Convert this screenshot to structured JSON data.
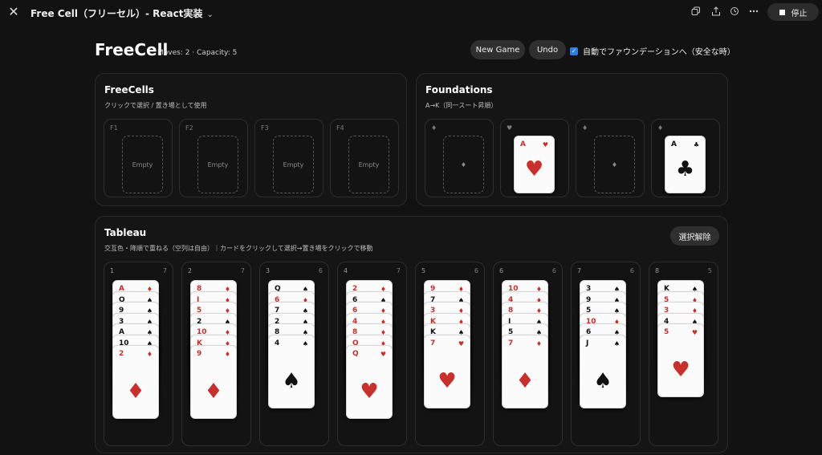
{
  "topbar": {
    "title": "Free Cell（フリーセル）- React実装",
    "chevron": "⌄",
    "close": "✕",
    "icons": [
      "copy-icon",
      "share-icon",
      "history-icon",
      "more-icon"
    ],
    "stop_label": "停止"
  },
  "header": {
    "title": "FreeCell",
    "subtitle": "Moves: 2 · Capacity: 5",
    "new_game": "New Game",
    "undo": "Undo",
    "auto_label": "自動でファウンデーションへ（安全な時）",
    "auto_checked": true
  },
  "freecells": {
    "title": "FreeCells",
    "subtitle": "クリックで選択 / 置き場として使用",
    "slots": [
      {
        "label": "F1",
        "text": "Empty"
      },
      {
        "label": "F2",
        "text": "Empty"
      },
      {
        "label": "F3",
        "text": "Empty"
      },
      {
        "label": "F4",
        "text": "Empty"
      }
    ]
  },
  "foundations": {
    "title": "Foundations",
    "subtitle": "A→K（同一スート昇順）",
    "piles": [
      {
        "label": "♦",
        "card": null,
        "empty_glyph": "♦"
      },
      {
        "label": "♥",
        "card": {
          "rank": "A",
          "suit": "♥",
          "color": "red"
        }
      },
      {
        "label": "♦",
        "card": null,
        "empty_glyph": "♦"
      },
      {
        "label": "♦",
        "card": {
          "rank": "A",
          "suit": "♣",
          "color": "black"
        }
      }
    ]
  },
  "tableau": {
    "title": "Tableau",
    "subtitle": "交互色・降順で重ねる（空列は自由）｜カードをクリックして選択→置き場をクリックで移動",
    "clear_label": "選択解除",
    "columns": [
      {
        "no": "1",
        "count": "7",
        "cards": [
          {
            "rank": "A",
            "suit": "♦",
            "color": "red"
          },
          {
            "rank": "Q",
            "suit": "♠",
            "color": "black"
          },
          {
            "rank": "9",
            "suit": "♠",
            "color": "black"
          },
          {
            "rank": "3",
            "suit": "♠",
            "color": "black"
          },
          {
            "rank": "A",
            "suit": "♠",
            "color": "black"
          },
          {
            "rank": "10",
            "suit": "♠",
            "color": "black"
          },
          {
            "rank": "2",
            "suit": "♦",
            "color": "red"
          }
        ]
      },
      {
        "no": "2",
        "count": "7",
        "cards": [
          {
            "rank": "8",
            "suit": "♦",
            "color": "red"
          },
          {
            "rank": "J",
            "suit": "♦",
            "color": "red"
          },
          {
            "rank": "5",
            "suit": "♦",
            "color": "red"
          },
          {
            "rank": "2",
            "suit": "♠",
            "color": "black"
          },
          {
            "rank": "10",
            "suit": "♦",
            "color": "red"
          },
          {
            "rank": "K",
            "suit": "♦",
            "color": "red"
          },
          {
            "rank": "9",
            "suit": "♦",
            "color": "red"
          }
        ]
      },
      {
        "no": "3",
        "count": "6",
        "cards": [
          {
            "rank": "Q",
            "suit": "♠",
            "color": "black"
          },
          {
            "rank": "6",
            "suit": "♦",
            "color": "red"
          },
          {
            "rank": "7",
            "suit": "♠",
            "color": "black"
          },
          {
            "rank": "2",
            "suit": "♠",
            "color": "black"
          },
          {
            "rank": "8",
            "suit": "♠",
            "color": "black"
          },
          {
            "rank": "4",
            "suit": "♠",
            "color": "black"
          }
        ]
      },
      {
        "no": "4",
        "count": "7",
        "cards": [
          {
            "rank": "2",
            "suit": "♦",
            "color": "red"
          },
          {
            "rank": "6",
            "suit": "♠",
            "color": "black"
          },
          {
            "rank": "6",
            "suit": "♦",
            "color": "red"
          },
          {
            "rank": "4",
            "suit": "♦",
            "color": "red"
          },
          {
            "rank": "8",
            "suit": "♦",
            "color": "red"
          },
          {
            "rank": "Q",
            "suit": "♦",
            "color": "red"
          },
          {
            "rank": "Q",
            "suit": "♥",
            "color": "red"
          }
        ]
      },
      {
        "no": "5",
        "count": "6",
        "cards": [
          {
            "rank": "9",
            "suit": "♦",
            "color": "red"
          },
          {
            "rank": "7",
            "suit": "♠",
            "color": "black"
          },
          {
            "rank": "3",
            "suit": "♦",
            "color": "red"
          },
          {
            "rank": "K",
            "suit": "♦",
            "color": "red"
          },
          {
            "rank": "K",
            "suit": "♠",
            "color": "black"
          },
          {
            "rank": "7",
            "suit": "♥",
            "color": "red"
          }
        ]
      },
      {
        "no": "6",
        "count": "6",
        "cards": [
          {
            "rank": "10",
            "suit": "♦",
            "color": "red"
          },
          {
            "rank": "4",
            "suit": "♦",
            "color": "red"
          },
          {
            "rank": "8",
            "suit": "♦",
            "color": "red"
          },
          {
            "rank": "J",
            "suit": "♠",
            "color": "black"
          },
          {
            "rank": "5",
            "suit": "♠",
            "color": "black"
          },
          {
            "rank": "7",
            "suit": "♦",
            "color": "red"
          }
        ]
      },
      {
        "no": "7",
        "count": "6",
        "cards": [
          {
            "rank": "3",
            "suit": "♠",
            "color": "black"
          },
          {
            "rank": "9",
            "suit": "♠",
            "color": "black"
          },
          {
            "rank": "5",
            "suit": "♠",
            "color": "black"
          },
          {
            "rank": "10",
            "suit": "♦",
            "color": "red"
          },
          {
            "rank": "6",
            "suit": "♠",
            "color": "black"
          },
          {
            "rank": "J",
            "suit": "♠",
            "color": "black"
          }
        ]
      },
      {
        "no": "8",
        "count": "5",
        "cards": [
          {
            "rank": "K",
            "suit": "♠",
            "color": "black"
          },
          {
            "rank": "5",
            "suit": "♦",
            "color": "red"
          },
          {
            "rank": "3",
            "suit": "♦",
            "color": "red"
          },
          {
            "rank": "4",
            "suit": "♠",
            "color": "black"
          },
          {
            "rank": "5",
            "suit": "♥",
            "color": "red"
          }
        ]
      }
    ]
  },
  "colors": {
    "red": "#c9302c",
    "black": "#111111",
    "accent": "#2b7de9"
  }
}
